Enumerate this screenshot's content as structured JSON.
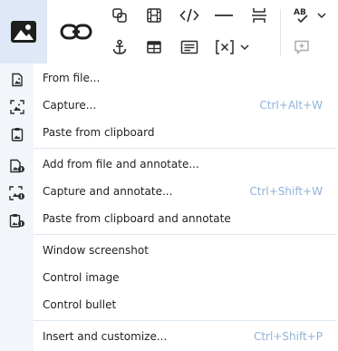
{
  "toolbar": {
    "groups": [
      {
        "name": "insert-image",
        "icon": "image-icon"
      },
      {
        "name": "insert-link",
        "icon": "link-icon"
      },
      {
        "name": "insert-media",
        "icons": [
          "link-special-icon",
          "film-icon",
          "code-icon",
          "horizontal-rule-icon",
          "page-break-icon",
          "anchor-icon",
          "table-icon",
          "text-box-icon",
          "field-icon"
        ]
      },
      {
        "name": "proofing",
        "icons": [
          "spellcheck-icon",
          "comment-icon"
        ]
      }
    ]
  },
  "menu": {
    "items": [
      {
        "label": "From file...",
        "shortcut": ""
      },
      {
        "label": "Capture...",
        "shortcut": "Ctrl+Alt+W"
      },
      {
        "label": "Paste from clipboard",
        "shortcut": ""
      },
      {
        "label": "Add from file and annotate...",
        "shortcut": ""
      },
      {
        "label": "Capture and annotate...",
        "shortcut": "Ctrl+Shift+W"
      },
      {
        "label": "Paste from clipboard and annotate",
        "shortcut": ""
      },
      {
        "label": "Window screenshot",
        "shortcut": ""
      },
      {
        "label": "Control image",
        "shortcut": ""
      },
      {
        "label": "Control bullet",
        "shortcut": ""
      },
      {
        "label": "Insert and customize...",
        "shortcut": "Ctrl+Shift+P"
      }
    ]
  },
  "colors": {
    "accent_bg": "#dfe8f6",
    "gutter_bg": "#f2f5fa",
    "shortcut": "#8fb3d9",
    "separator": "#dde6ef"
  }
}
